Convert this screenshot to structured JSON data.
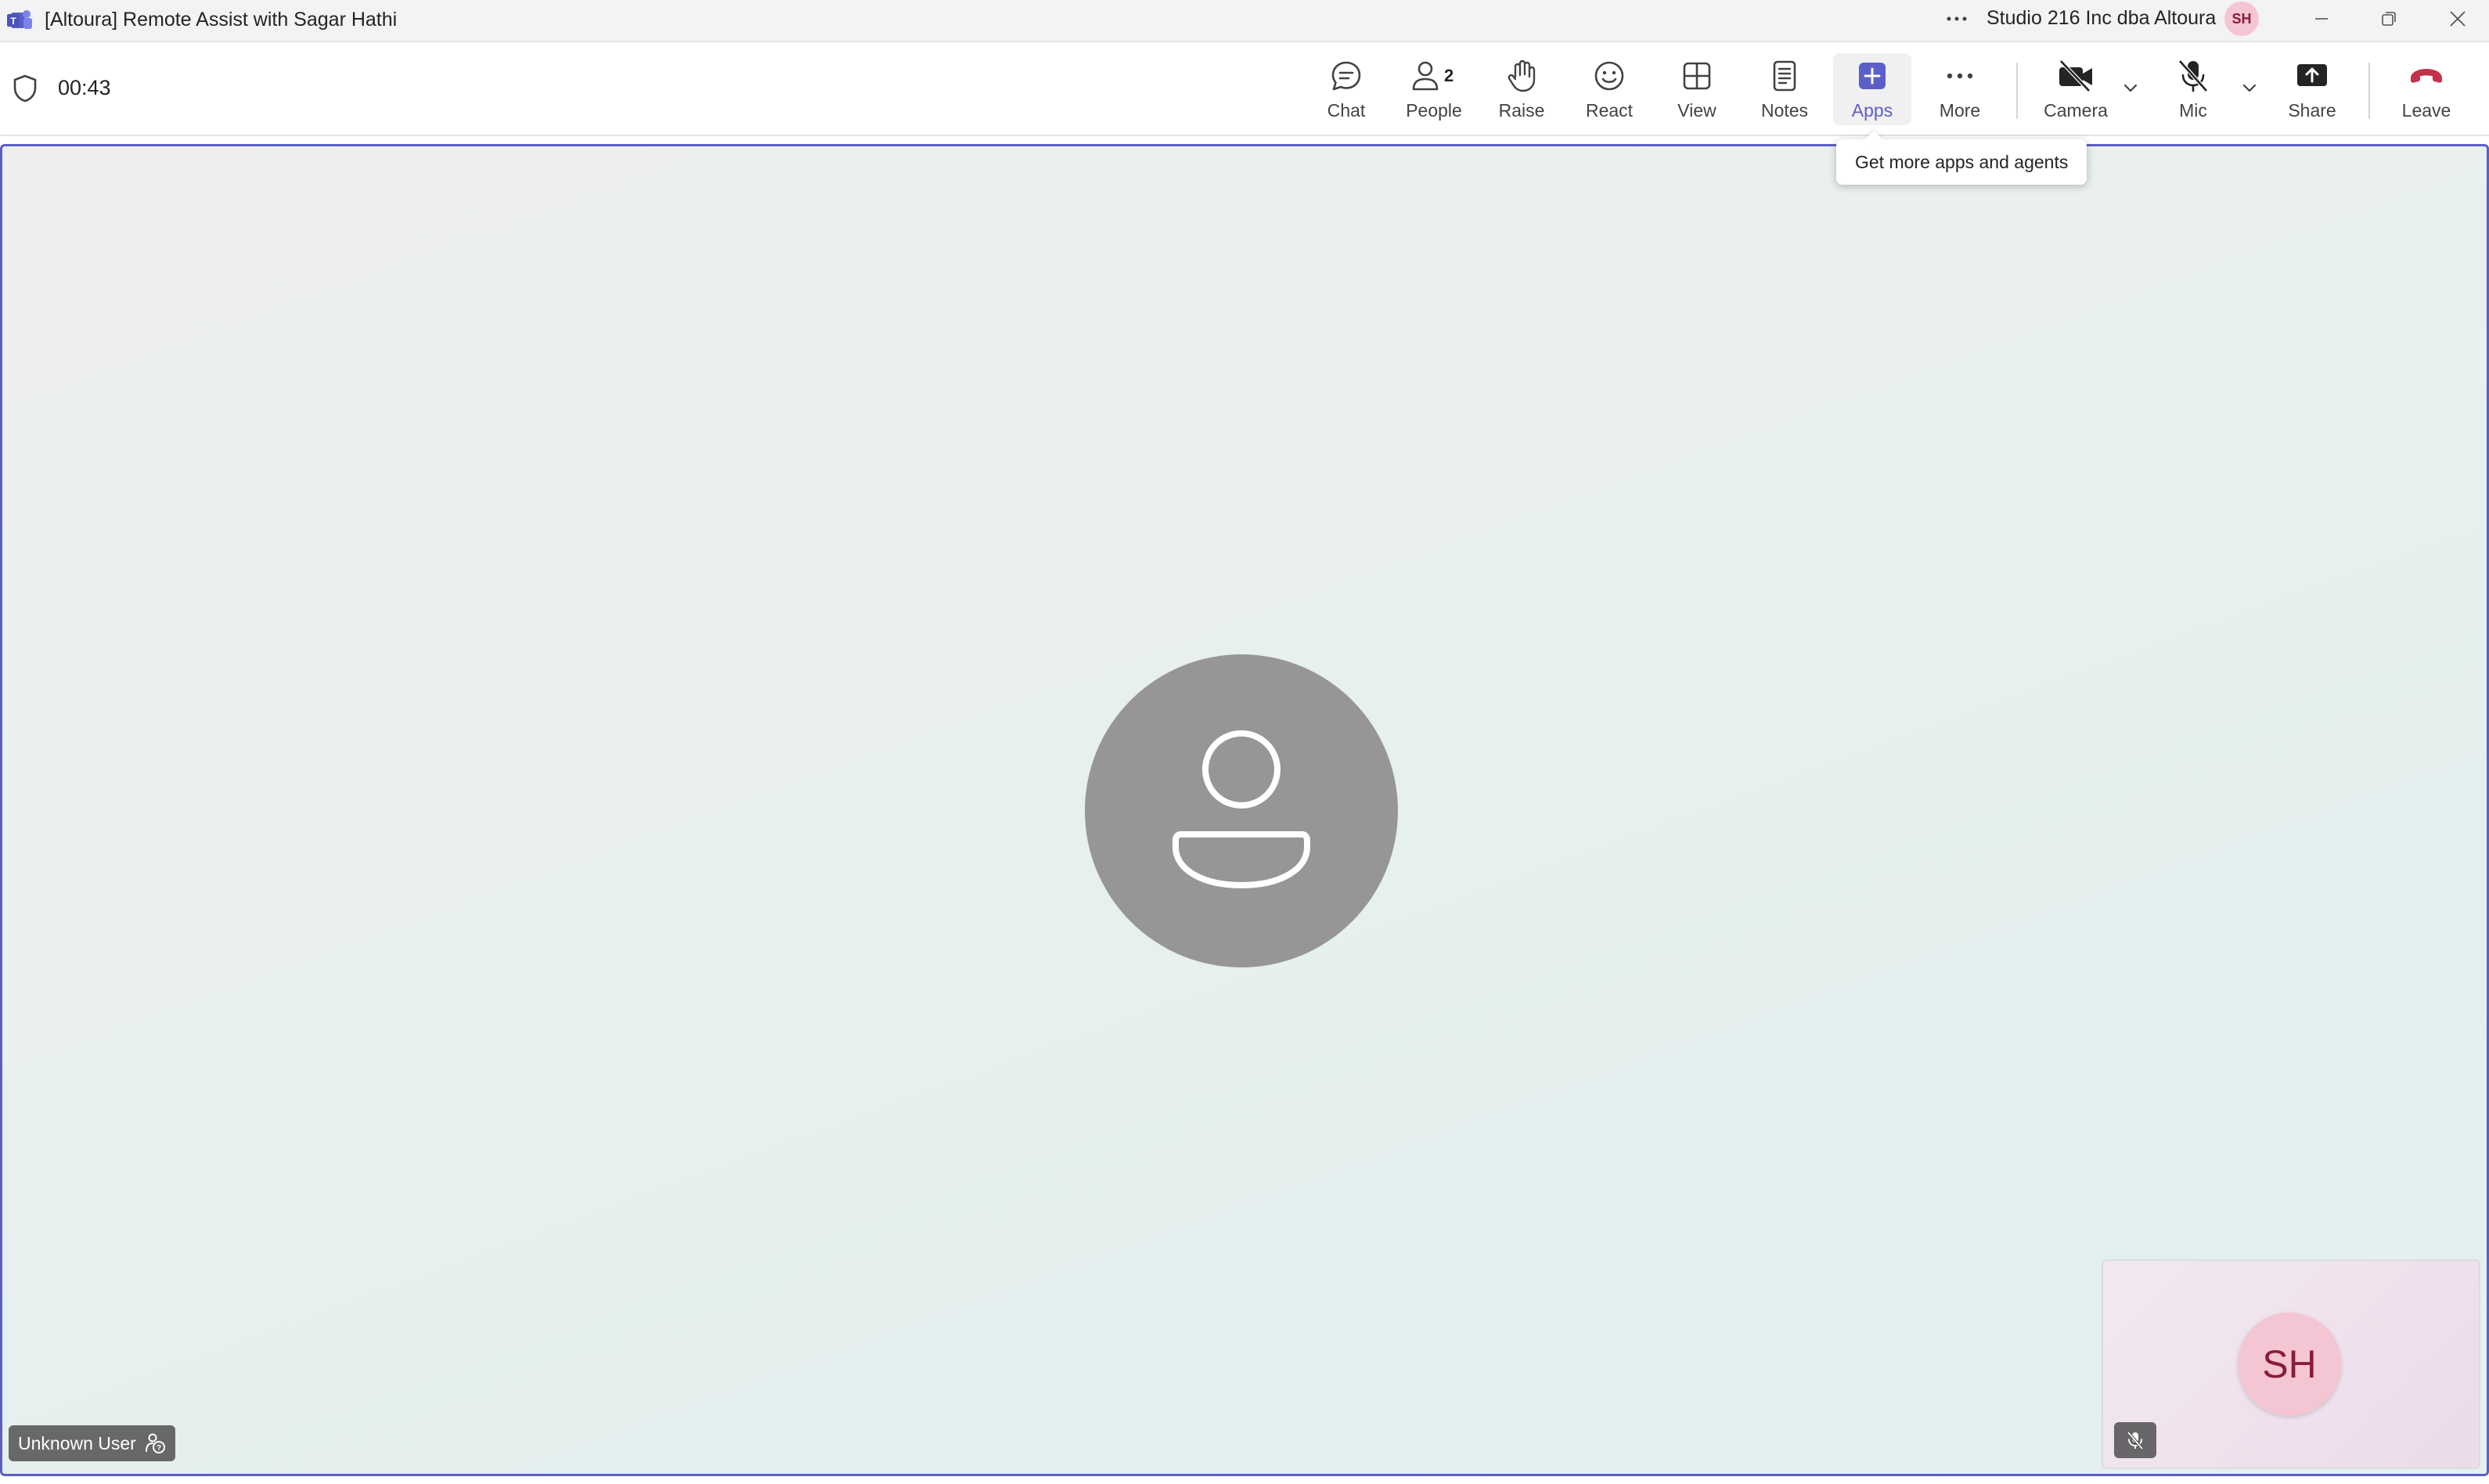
{
  "window": {
    "title": "[Altoura] Remote Assist with Sagar Hathi",
    "org_name": "Studio 216 Inc dba Altoura",
    "user_initials": "SH"
  },
  "meeting": {
    "timer": "00:43",
    "people_count": "2"
  },
  "toolbar": {
    "chat": "Chat",
    "people": "People",
    "raise": "Raise",
    "react": "React",
    "view": "View",
    "notes": "Notes",
    "apps": "Apps",
    "more": "More",
    "camera": "Camera",
    "mic": "Mic",
    "share": "Share",
    "leave": "Leave"
  },
  "tooltip": {
    "apps": "Get more apps and agents"
  },
  "stage": {
    "participant_name": "Unknown User",
    "self_initials": "SH"
  },
  "colors": {
    "accent": "#5b5fc7",
    "leave_red": "#c4314b",
    "avatar_pink": "#f4c6d4"
  },
  "icons": [
    "teams-logo-icon",
    "more-dots-icon",
    "minimize-icon",
    "restore-icon",
    "close-icon",
    "shield-icon",
    "chat-icon",
    "people-icon",
    "raise-hand-icon",
    "react-icon",
    "view-icon",
    "notes-icon",
    "apps-icon",
    "more-icon",
    "camera-off-icon",
    "mic-off-icon",
    "chevron-down-icon",
    "share-icon",
    "leave-icon",
    "person-icon",
    "unknown-user-icon"
  ]
}
